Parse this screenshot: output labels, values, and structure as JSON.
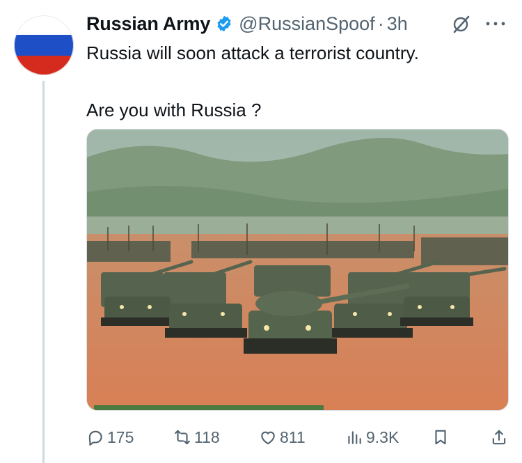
{
  "author": {
    "display_name": "Russian Army",
    "handle": "@RussianSpoof",
    "separator": "·",
    "time": "3h",
    "avatar": "russian-flag",
    "flag_colors": [
      "#ffffff",
      "#1f4fc7",
      "#d52b1e"
    ],
    "verified_color": "#1d9bf0"
  },
  "tweet": {
    "lines": [
      "Russia will soon attack a terrorist country.",
      "Are you with Russia ?"
    ]
  },
  "media": {
    "subject": "rows of green military tanks on orange dirt field with hills behind"
  },
  "actions": {
    "replies": "175",
    "reposts": "118",
    "likes": "811",
    "views": "9.3K"
  },
  "icons": [
    "verified-icon",
    "grok-icon",
    "more-icon",
    "reply-icon",
    "repost-icon",
    "like-icon",
    "views-icon",
    "bookmark-icon",
    "share-icon"
  ],
  "colors": {
    "text": "#0f1419",
    "secondary": "#536471",
    "thread_line": "#cfd9de"
  }
}
